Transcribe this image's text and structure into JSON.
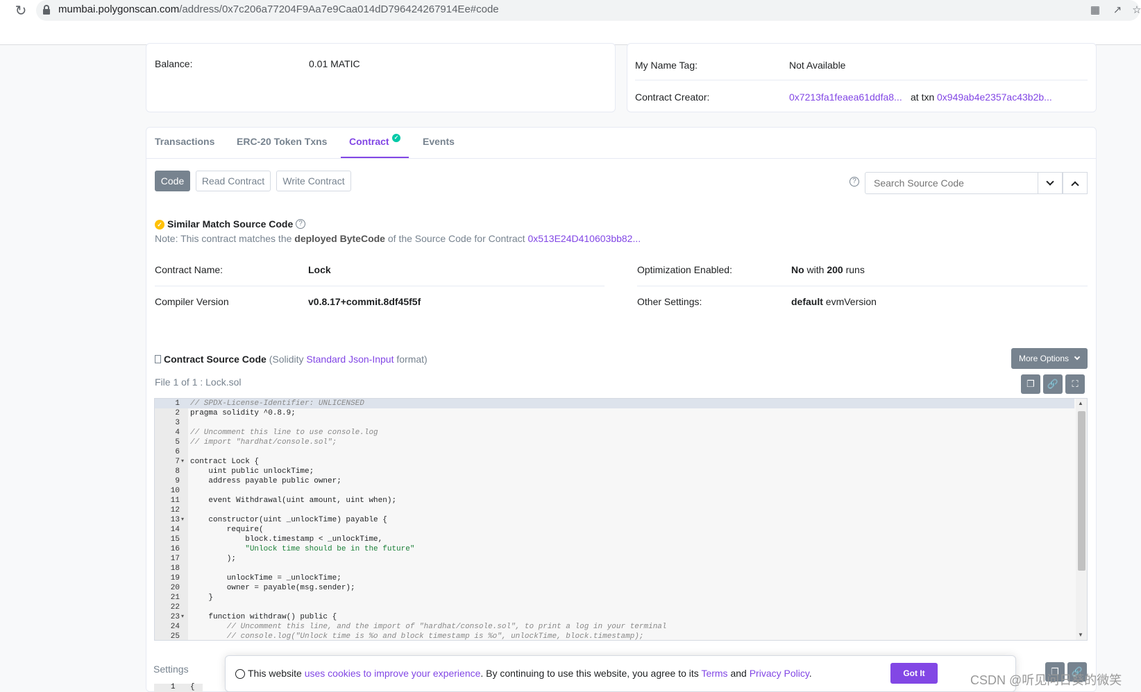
{
  "browser": {
    "url_host": "mumbai.polygonscan.com",
    "url_path": "/address/0x7c206a77204F9Aa7e9Caa014dD796424267914Ee#code"
  },
  "overview": {
    "balance_label": "Balance:",
    "balance_value": "0.01 MATIC",
    "name_tag_label": "My Name Tag:",
    "name_tag_value": "Not Available",
    "creator_label": "Contract Creator:",
    "creator_address": "0x7213fa1feaea61ddfa8...",
    "at_txn": "at txn",
    "creator_txn": "0x949ab4e2357ac43b2b..."
  },
  "tabs": [
    "Transactions",
    "ERC-20 Token Txns",
    "Contract",
    "Events"
  ],
  "code_buttons": {
    "code": "Code",
    "read": "Read Contract",
    "write": "Write Contract",
    "search_placeholder": "Search Source Code"
  },
  "match": {
    "title": "Similar Match Source Code",
    "note_prefix": "Note: This contract matches the ",
    "note_bold": "deployed ByteCode",
    "note_suffix": " of the Source Code for Contract ",
    "note_link": "0x513E24D410603bb82..."
  },
  "details": {
    "name_label": "Contract Name:",
    "name_value": "Lock",
    "compiler_label": "Compiler Version",
    "compiler_value": "v0.8.17+commit.8df45f5f",
    "opt_label": "Optimization Enabled:",
    "opt_no": "No",
    "opt_with": " with ",
    "opt_runs": "200",
    "opt_runs_suffix": " runs",
    "other_label": "Other Settings:",
    "other_bold": "default",
    "other_value": " evmVersion"
  },
  "source": {
    "title": "Contract Source Code",
    "format_prefix": "(Solidity ",
    "format_link": "Standard Json-Input",
    "format_suffix": " format)",
    "file_label": "File 1 of 1 : Lock.sol",
    "more_options": "More Options"
  },
  "code_lines": [
    {
      "n": "1",
      "t": "// SPDX-License-Identifier: UNLICENSED"
    },
    {
      "n": "2",
      "t": "pragma solidity ^0.8.9;"
    },
    {
      "n": "3",
      "t": ""
    },
    {
      "n": "4",
      "t": "// Uncomment this line to use console.log"
    },
    {
      "n": "5",
      "t": "// import \"hardhat/console.sol\";"
    },
    {
      "n": "6",
      "t": ""
    },
    {
      "n": "7",
      "t": "contract Lock {"
    },
    {
      "n": "8",
      "t": "    uint public unlockTime;"
    },
    {
      "n": "9",
      "t": "    address payable public owner;"
    },
    {
      "n": "10",
      "t": ""
    },
    {
      "n": "11",
      "t": "    event Withdrawal(uint amount, uint when);"
    },
    {
      "n": "12",
      "t": ""
    },
    {
      "n": "13",
      "t": "    constructor(uint _unlockTime) payable {"
    },
    {
      "n": "14",
      "t": "        require("
    },
    {
      "n": "15",
      "t": "            block.timestamp < _unlockTime,"
    },
    {
      "n": "16",
      "t": "            \"Unlock time should be in the future\""
    },
    {
      "n": "17",
      "t": "        );"
    },
    {
      "n": "18",
      "t": ""
    },
    {
      "n": "19",
      "t": "        unlockTime = _unlockTime;"
    },
    {
      "n": "20",
      "t": "        owner = payable(msg.sender);"
    },
    {
      "n": "21",
      "t": "    }"
    },
    {
      "n": "22",
      "t": ""
    },
    {
      "n": "23",
      "t": "    function withdraw() public {"
    },
    {
      "n": "24",
      "t": "        // Uncomment this line, and the import of \"hardhat/console.sol\", to print a log in your terminal"
    },
    {
      "n": "25",
      "t": "        // console.log(\"Unlock time is %o and block timestamp is %o\", unlockTime, block.timestamp);"
    }
  ],
  "settings": {
    "label": "Settings",
    "first_line_num": "1",
    "first_line_code": "{"
  },
  "cookie": {
    "prefix": "This website ",
    "link": "uses cookies to improve your experience",
    "middle": ". By continuing to use this website, you agree to its ",
    "terms": "Terms",
    "and": " and ",
    "privacy": "Privacy Policy",
    "dot": ".",
    "button": "Got It"
  },
  "watermark": "CSDN @听见问日葵的微笑",
  "colors": {
    "accent": "#8247e5",
    "muted": "#77838f",
    "success": "#00c9a7",
    "warning": "#ffc107"
  }
}
